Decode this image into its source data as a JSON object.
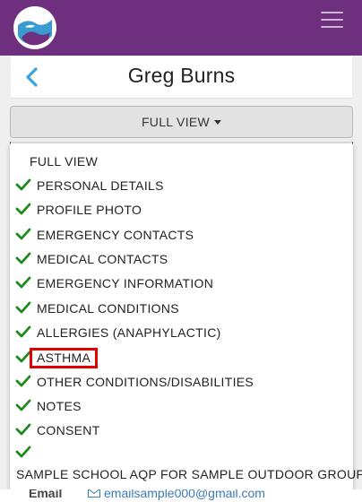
{
  "header": {
    "brand_color": "#6e2f7e",
    "logo_icon": "shield-wave-logo",
    "menu_icon": "hamburger-icon"
  },
  "profile": {
    "name": "Greg Burns",
    "back_icon": "chevron-left-icon"
  },
  "view_selector": {
    "selected": "FULL VIEW",
    "caret_icon": "caret-down-icon"
  },
  "dropdown": {
    "items": [
      {
        "label": "FULL VIEW",
        "checked": false
      },
      {
        "label": "PERSONAL DETAILS",
        "checked": true
      },
      {
        "label": "PROFILE PHOTO",
        "checked": true
      },
      {
        "label": "EMERGENCY CONTACTS",
        "checked": true
      },
      {
        "label": "MEDICAL CONTACTS",
        "checked": true
      },
      {
        "label": "EMERGENCY INFORMATION",
        "checked": true
      },
      {
        "label": "MEDICAL CONDITIONS",
        "checked": true
      },
      {
        "label": "ALLERGIES (ANAPHYLACTIC)",
        "checked": true
      },
      {
        "label": "ASTHMA",
        "checked": true,
        "highlighted": true
      },
      {
        "label": "OTHER CONDITIONS/DISABILITIES",
        "checked": true
      },
      {
        "label": "NOTES",
        "checked": true
      },
      {
        "label": "CONSENT",
        "checked": true
      },
      {
        "label": "",
        "checked": true
      },
      {
        "label": "SAMPLE SCHOOL AQP FOR SAMPLE OUTDOOR GROUP",
        "checked": false
      }
    ],
    "check_color": "#1e8a1e",
    "highlight_color": "#e00000"
  },
  "background_row": {
    "label": "Email",
    "value": "emailsample000@gmail.com",
    "icon": "mail-icon"
  }
}
